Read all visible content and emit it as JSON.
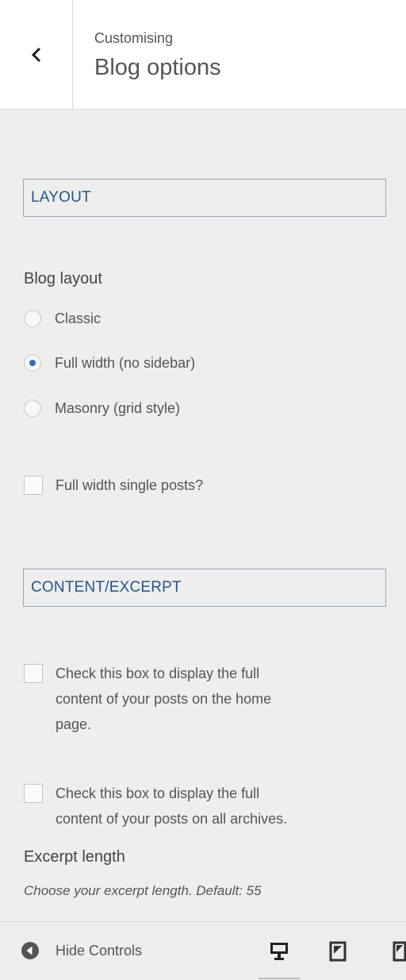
{
  "header": {
    "back_icon": "chevron-left-icon",
    "pre_title": "Customising",
    "title": "Blog options"
  },
  "sections": {
    "layout_label": "LAYOUT",
    "content_label": "CONTENT/EXCERPT"
  },
  "blog_layout": {
    "label": "Blog layout",
    "options": [
      {
        "label": "Classic",
        "checked": false
      },
      {
        "label": "Full width (no sidebar)",
        "checked": true
      },
      {
        "label": "Masonry (grid style)",
        "checked": false
      }
    ]
  },
  "single_posts": {
    "label": "Full width single posts?",
    "checked": false
  },
  "content": {
    "home_lines": [
      "Check this box to display the full",
      "content of your posts on the home",
      "page."
    ],
    "archives_lines": [
      "Check this box to display the full",
      "content of your posts on all archives."
    ]
  },
  "excerpt": {
    "label": "Excerpt length",
    "description": "Choose your excerpt length. Default: 55"
  },
  "footer": {
    "hide_controls_label": "Hide Controls",
    "hide_icon": "collapse-arrow-icon",
    "devices": [
      "desktop-icon",
      "tablet-icon",
      "mobile-icon"
    ]
  },
  "colors": {
    "accent": "#2e72b4",
    "section_text": "#27558a",
    "background": "#eeeeee"
  }
}
